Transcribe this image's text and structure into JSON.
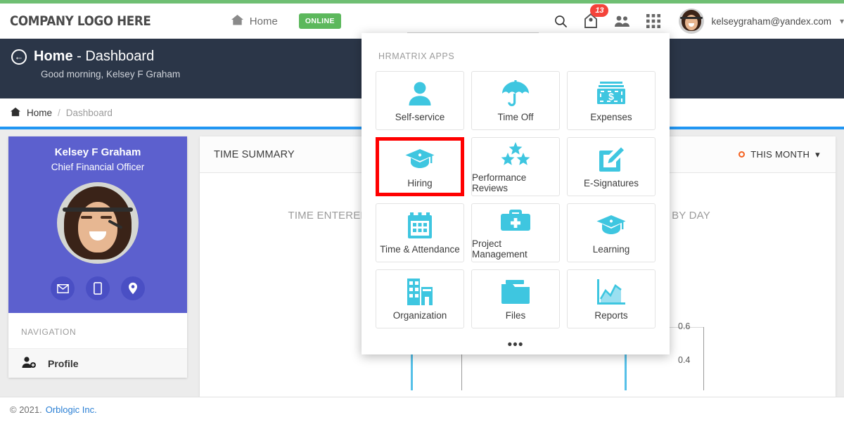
{
  "brand": {
    "logo_text": "COMPANY LOGO HERE",
    "accent_green": "#6fbf73",
    "accent_blue": "#2196f3",
    "accent_teal": "#3ec6e0",
    "accent_purple": "#5c60ce",
    "highlight_red": "#ff0000",
    "badge_orange": "#f4601f"
  },
  "topbar": {
    "home_label": "Home",
    "home_icon": "home-icon",
    "status_badge": "ONLINE",
    "search_placeholder": "",
    "search_value": "",
    "search_icon": "search-icon",
    "notifications_icon": "tag-icon",
    "notifications_count": "13",
    "people_icon": "people-icon",
    "apps_icon": "grid-apps-icon",
    "avatar_icon": "user-avatar",
    "user_email": "kelseygraham@yandex.com",
    "caret_icon": "chevron-down-icon"
  },
  "page_header": {
    "back_icon": "back-arrow-icon",
    "title_main": "Home",
    "title_sep": " - ",
    "title_sub": "Dashboard",
    "greeting": "Good morning, Kelsey F Graham"
  },
  "breadcrumb": {
    "home_icon": "home-icon",
    "home": "Home",
    "separator": "/",
    "current": "Dashboard"
  },
  "sidebar": {
    "name": "Kelsey F Graham",
    "role": "Chief Financial Officer",
    "photo": "profile-photo",
    "actions": [
      {
        "name": "email-action",
        "icon": "envelope-icon",
        "glyph": "✉"
      },
      {
        "name": "mobile-action",
        "icon": "mobile-phone-icon",
        "glyph": "▯"
      },
      {
        "name": "location-action",
        "icon": "map-pin-icon",
        "glyph": "●"
      }
    ],
    "nav_heading": "NAVIGATION",
    "items": [
      {
        "label": "Profile",
        "icon": "user-add-icon"
      }
    ]
  },
  "summary": {
    "title": "TIME SUMMARY",
    "range_label": "THIS MONTH",
    "range_dot": "record-dot-icon",
    "range_caret": "chevron-down-icon"
  },
  "chart_data": [
    {
      "type": "bar",
      "title": "TIME ENTERED BY STATUS",
      "categories": [],
      "values": [],
      "ytick_labels": [
        "0.6"
      ],
      "ylim": [
        0,
        1
      ],
      "grid": true,
      "legend": "none",
      "note": "plot area mostly occluded by apps panel"
    },
    {
      "type": "bar",
      "title": "TIME BY DAY",
      "categories": [],
      "values": [],
      "ytick_labels": [
        "0.6",
        "0.4"
      ],
      "ylim": [
        0,
        1
      ],
      "grid": true,
      "legend": "none",
      "note": "plot area mostly occluded by apps panel"
    }
  ],
  "apps_panel": {
    "heading": "HRMATRIX APPS",
    "more_label": "•••",
    "apps": [
      {
        "label": "Self-service",
        "icon": "person-icon",
        "highlighted": false
      },
      {
        "label": "Time Off",
        "icon": "umbrella-icon",
        "highlighted": false
      },
      {
        "label": "Expenses",
        "icon": "money-bill-icon",
        "highlighted": false
      },
      {
        "label": "Hiring",
        "icon": "graduation-cap-icon",
        "highlighted": true
      },
      {
        "label": "Performance Reviews",
        "icon": "stars-icon",
        "highlighted": false
      },
      {
        "label": "E-Signatures",
        "icon": "pencil-square-icon",
        "highlighted": false
      },
      {
        "label": "Time & Attendance",
        "icon": "calendar-icon",
        "highlighted": false
      },
      {
        "label": "Project Management",
        "icon": "briefcase-icon",
        "highlighted": false
      },
      {
        "label": "Learning",
        "icon": "graduation-cap-icon",
        "highlighted": false
      },
      {
        "label": "Organization",
        "icon": "building-icon",
        "highlighted": false
      },
      {
        "label": "Files",
        "icon": "folder-icon",
        "highlighted": false
      },
      {
        "label": "Reports",
        "icon": "area-chart-icon",
        "highlighted": false
      }
    ]
  },
  "footer": {
    "copyright": "© 2021.",
    "company": "Orblogic Inc."
  }
}
